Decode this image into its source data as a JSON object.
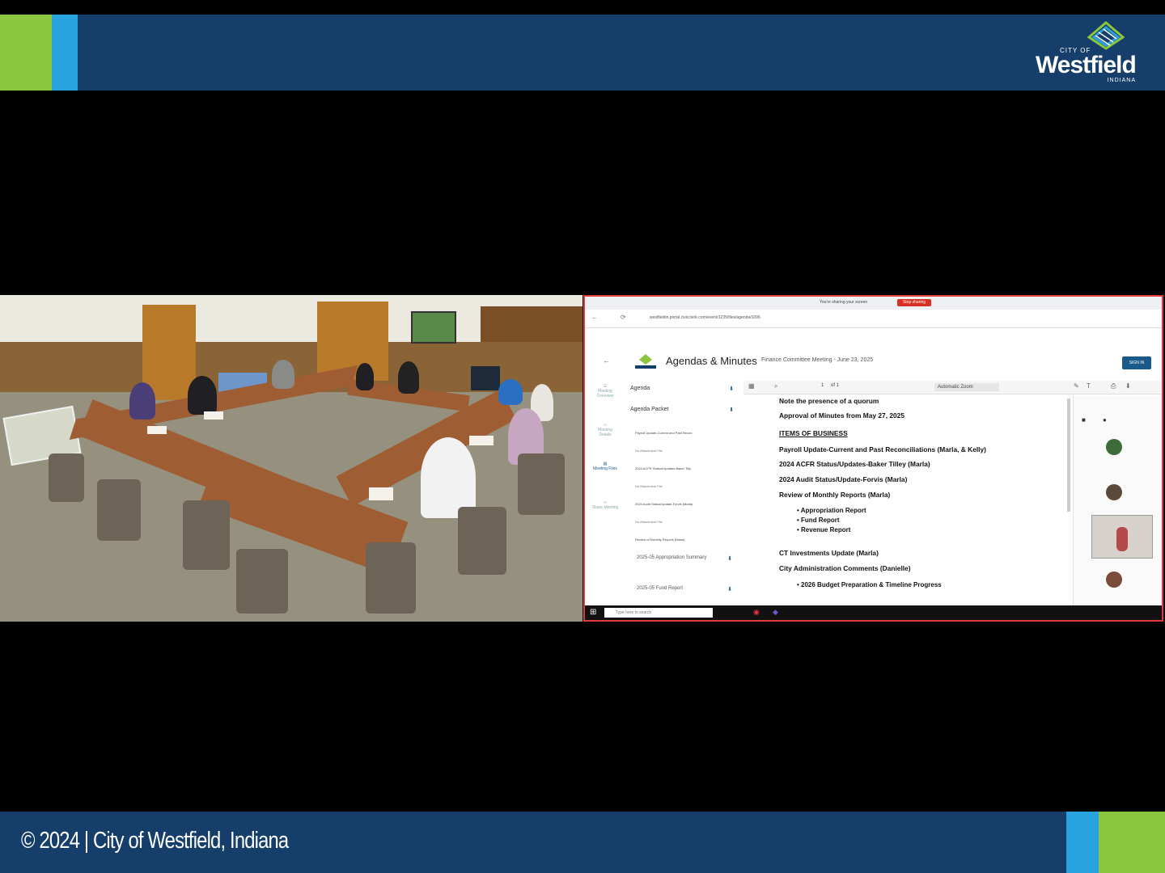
{
  "branding": {
    "logo": {
      "city_of": "CITY OF",
      "name": "Westfield",
      "state": "INDIANA"
    },
    "copyright": "© 2024 | City of Westfield, Indiana",
    "colors": {
      "navy": "#153e6b",
      "green": "#8cc63f",
      "cyan": "#29a3e0"
    }
  },
  "screen_share": {
    "browser": {
      "sharing_notice": "You're sharing your screen",
      "stop_sharing": "Stop sharing",
      "url": "westfieldin.portal.civicclerk.com/event/1235/files/agenda/1096"
    },
    "site": {
      "title": "Agendas & Minutes",
      "meeting": "Finance Committee Meeting - June 23, 2025",
      "sign_in": "SIGN IN"
    },
    "side_nav": [
      {
        "label": "Meeting Overview",
        "icon": "overview-icon"
      },
      {
        "label": "Meeting Details",
        "icon": "details-icon"
      },
      {
        "label": "Meeting Files",
        "icon": "files-icon"
      },
      {
        "label": "Share Meeting",
        "icon": "share-icon"
      }
    ],
    "agenda_nav": {
      "items": [
        {
          "label": "Agenda"
        },
        {
          "label": "Agenda Packet"
        }
      ],
      "attachments": [
        {
          "title": "Payroll Update-Current and Past Recon",
          "note": "No Attachment File"
        },
        {
          "title": "2024 ACFR Status/Updates-Baker Tilly",
          "note": "No Attachment File"
        },
        {
          "title": "2024 Audit Status/Update-Forvis (Marla)",
          "note": "No Attachment File"
        },
        {
          "title": "Review of Monthly Reports (Marla)",
          "note": ""
        }
      ],
      "files": [
        {
          "label": "2025-05 Appropriation Summary"
        },
        {
          "label": "2025-05 Fund Report"
        }
      ]
    },
    "pdf_toolbar": {
      "zoom": "Automatic Zoom",
      "page": "1",
      "of": "of 1"
    },
    "pdf_lines": [
      "Note the presence of a quorum",
      "Approval of Minutes from May 27, 2025",
      "ITEMS OF BUSINESS",
      "Payroll Update-Current and Past Reconciliations (Marla, & Kelly)",
      "2024 ACFR Status/Updates-Baker Tilley (Marla)",
      "2024 Audit Status/Update-Forvis (Marla)",
      "Review of Monthly Reports (Marla)"
    ],
    "pdf_bullets_1": [
      "Appropriation Report",
      "Fund Report",
      "Revenue Report"
    ],
    "pdf_lines_2": [
      "CT Investments Update (Marla)",
      "City Administration Comments (Danielle)"
    ],
    "pdf_bullets_2": [
      "2026 Budget Preparation & Timeline Progress"
    ],
    "taskbar": {
      "search_placeholder": "Type here to search"
    }
  }
}
